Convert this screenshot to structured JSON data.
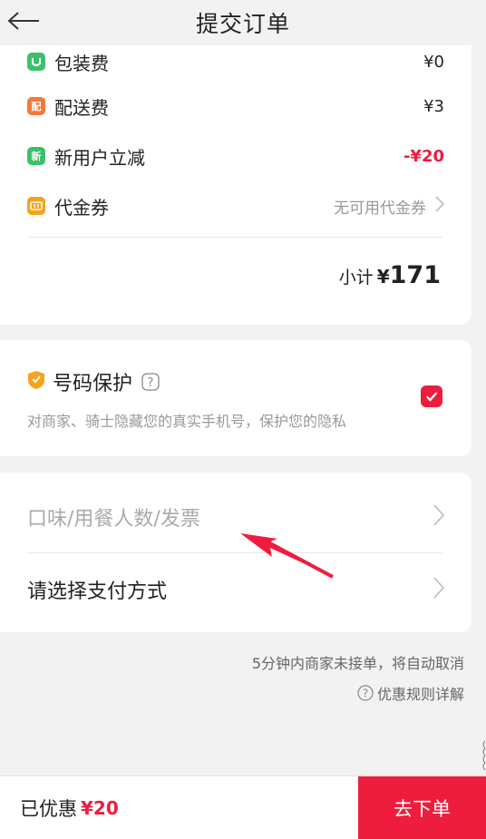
{
  "header": {
    "title": "提交订单",
    "back_icon": "arrow-left-icon"
  },
  "fees": {
    "packaging": {
      "icon_text": "",
      "label": "包装费",
      "value": "¥0",
      "icon": "packaging-icon",
      "color": "#3cc06b"
    },
    "delivery": {
      "icon_text": "配",
      "label": "配送费",
      "value": "¥3",
      "icon": "delivery-icon",
      "color": "#f5793b"
    },
    "new_user": {
      "icon_text": "新",
      "label": "新用户立减",
      "value": "-¥20",
      "icon": "new-user-icon",
      "color": "#3cc06b"
    },
    "voucher": {
      "label": "代金券",
      "value": "无可用代金券",
      "icon": "voucher-icon",
      "color": "#f7a21b"
    },
    "subtotal": {
      "label": "小计",
      "currency": "¥",
      "amount": "171"
    }
  },
  "privacy": {
    "title": "号码保护",
    "description": "对商家、骑士隐藏您的真实手机号，保护您的隐私",
    "checked": true,
    "shield_color": "#f7a21b"
  },
  "options": {
    "preferences_label": "口味/用餐人数/发票",
    "payment_label": "请选择支付方式"
  },
  "notice": {
    "auto_cancel": "5分钟内商家未接单，将自动取消",
    "rules_link": "优惠规则详解"
  },
  "bottom_bar": {
    "discount_label": "已优惠",
    "discount_value": "¥20",
    "submit_label": "去下单"
  },
  "colors": {
    "accent": "#ee1d3d",
    "background": "#f2f2f2"
  }
}
